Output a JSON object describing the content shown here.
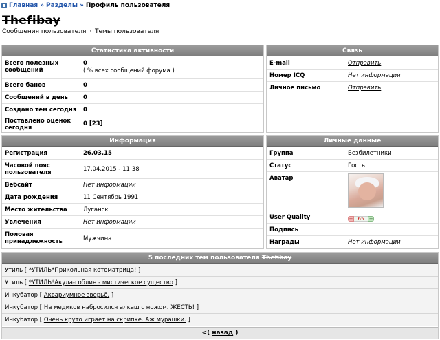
{
  "breadcrumb": {
    "home": "Главная",
    "sep1": "»",
    "sections": "Разделы",
    "sep2": "»",
    "current": "Профиль пользователя"
  },
  "profile": {
    "username": "Thefibay",
    "messages_link": "Сообщения пользователя",
    "dot": "·",
    "topics_link": "Темы пользователя"
  },
  "stats": {
    "header": "Статистика активности",
    "rows": [
      {
        "label": "Всего полезных сообщений",
        "value": "0",
        "sub": "( % всех сообщений форума )"
      },
      {
        "label": "Всего банов",
        "value": "0"
      },
      {
        "label": "Сообщений в день",
        "value": "0"
      },
      {
        "label": "Создано тем сегодня",
        "value": "0"
      },
      {
        "label": "Поставлено оценок сегодня",
        "value": "0 [23]"
      }
    ]
  },
  "contact": {
    "header": "Связь",
    "rows": [
      {
        "label": "E-mail",
        "value": "Отправить"
      },
      {
        "label": "Номер ICQ",
        "value": "Нет информации"
      },
      {
        "label": "Личное письмо",
        "value": "Отправить"
      }
    ]
  },
  "info": {
    "header": "Информация",
    "rows": [
      {
        "label": "Регистрация",
        "value": "26.03.15"
      },
      {
        "label": "Часовой пояс пользователя",
        "value": "17.04.2015 - 11:38"
      },
      {
        "label": "Вебсайт",
        "value": "Нет информации"
      },
      {
        "label": "Дата рождения",
        "value": "11 Сентябрь 1991"
      },
      {
        "label": "Место жительства",
        "value": "Луганск"
      },
      {
        "label": "Увлечения",
        "value": "Нет информации"
      },
      {
        "label": "Половая принадлежность",
        "value": "Мужчина"
      }
    ]
  },
  "personal": {
    "header": "Личные данные",
    "rows": [
      {
        "label": "Группа",
        "value": "Безбилетники"
      },
      {
        "label": "Статус",
        "value": "Гость"
      },
      {
        "label": "Аватар",
        "value": ""
      },
      {
        "label": "User Quality",
        "value": ""
      },
      {
        "label": "Подпись",
        "value": ""
      },
      {
        "label": "Награды",
        "value": "Нет информации"
      }
    ],
    "quality": {
      "minus": "−",
      "score": "65",
      "plus": "+"
    }
  },
  "topics": {
    "header_prefix": "5 последних тем пользователя",
    "header_user": "Thefibay",
    "items": [
      {
        "section": "Утиль",
        "title": "*УТИЛЬ*Прикольная котоматрица!"
      },
      {
        "section": "Утиль",
        "title": "*УТИЛЬ*Акула-гоблин - мистическое существо"
      },
      {
        "section": "Инкубатор",
        "title": "Аквариумное зверьё."
      },
      {
        "section": "Инкубатор",
        "title": "На медиков набросился алкаш с ножом. ЖЕСТЬ!"
      },
      {
        "section": "Инкубатор",
        "title": "Очень круто играет на скрипке. Аж мурашки."
      }
    ],
    "back_prefix": "<(",
    "back": "назад",
    "back_suffix": ")"
  }
}
